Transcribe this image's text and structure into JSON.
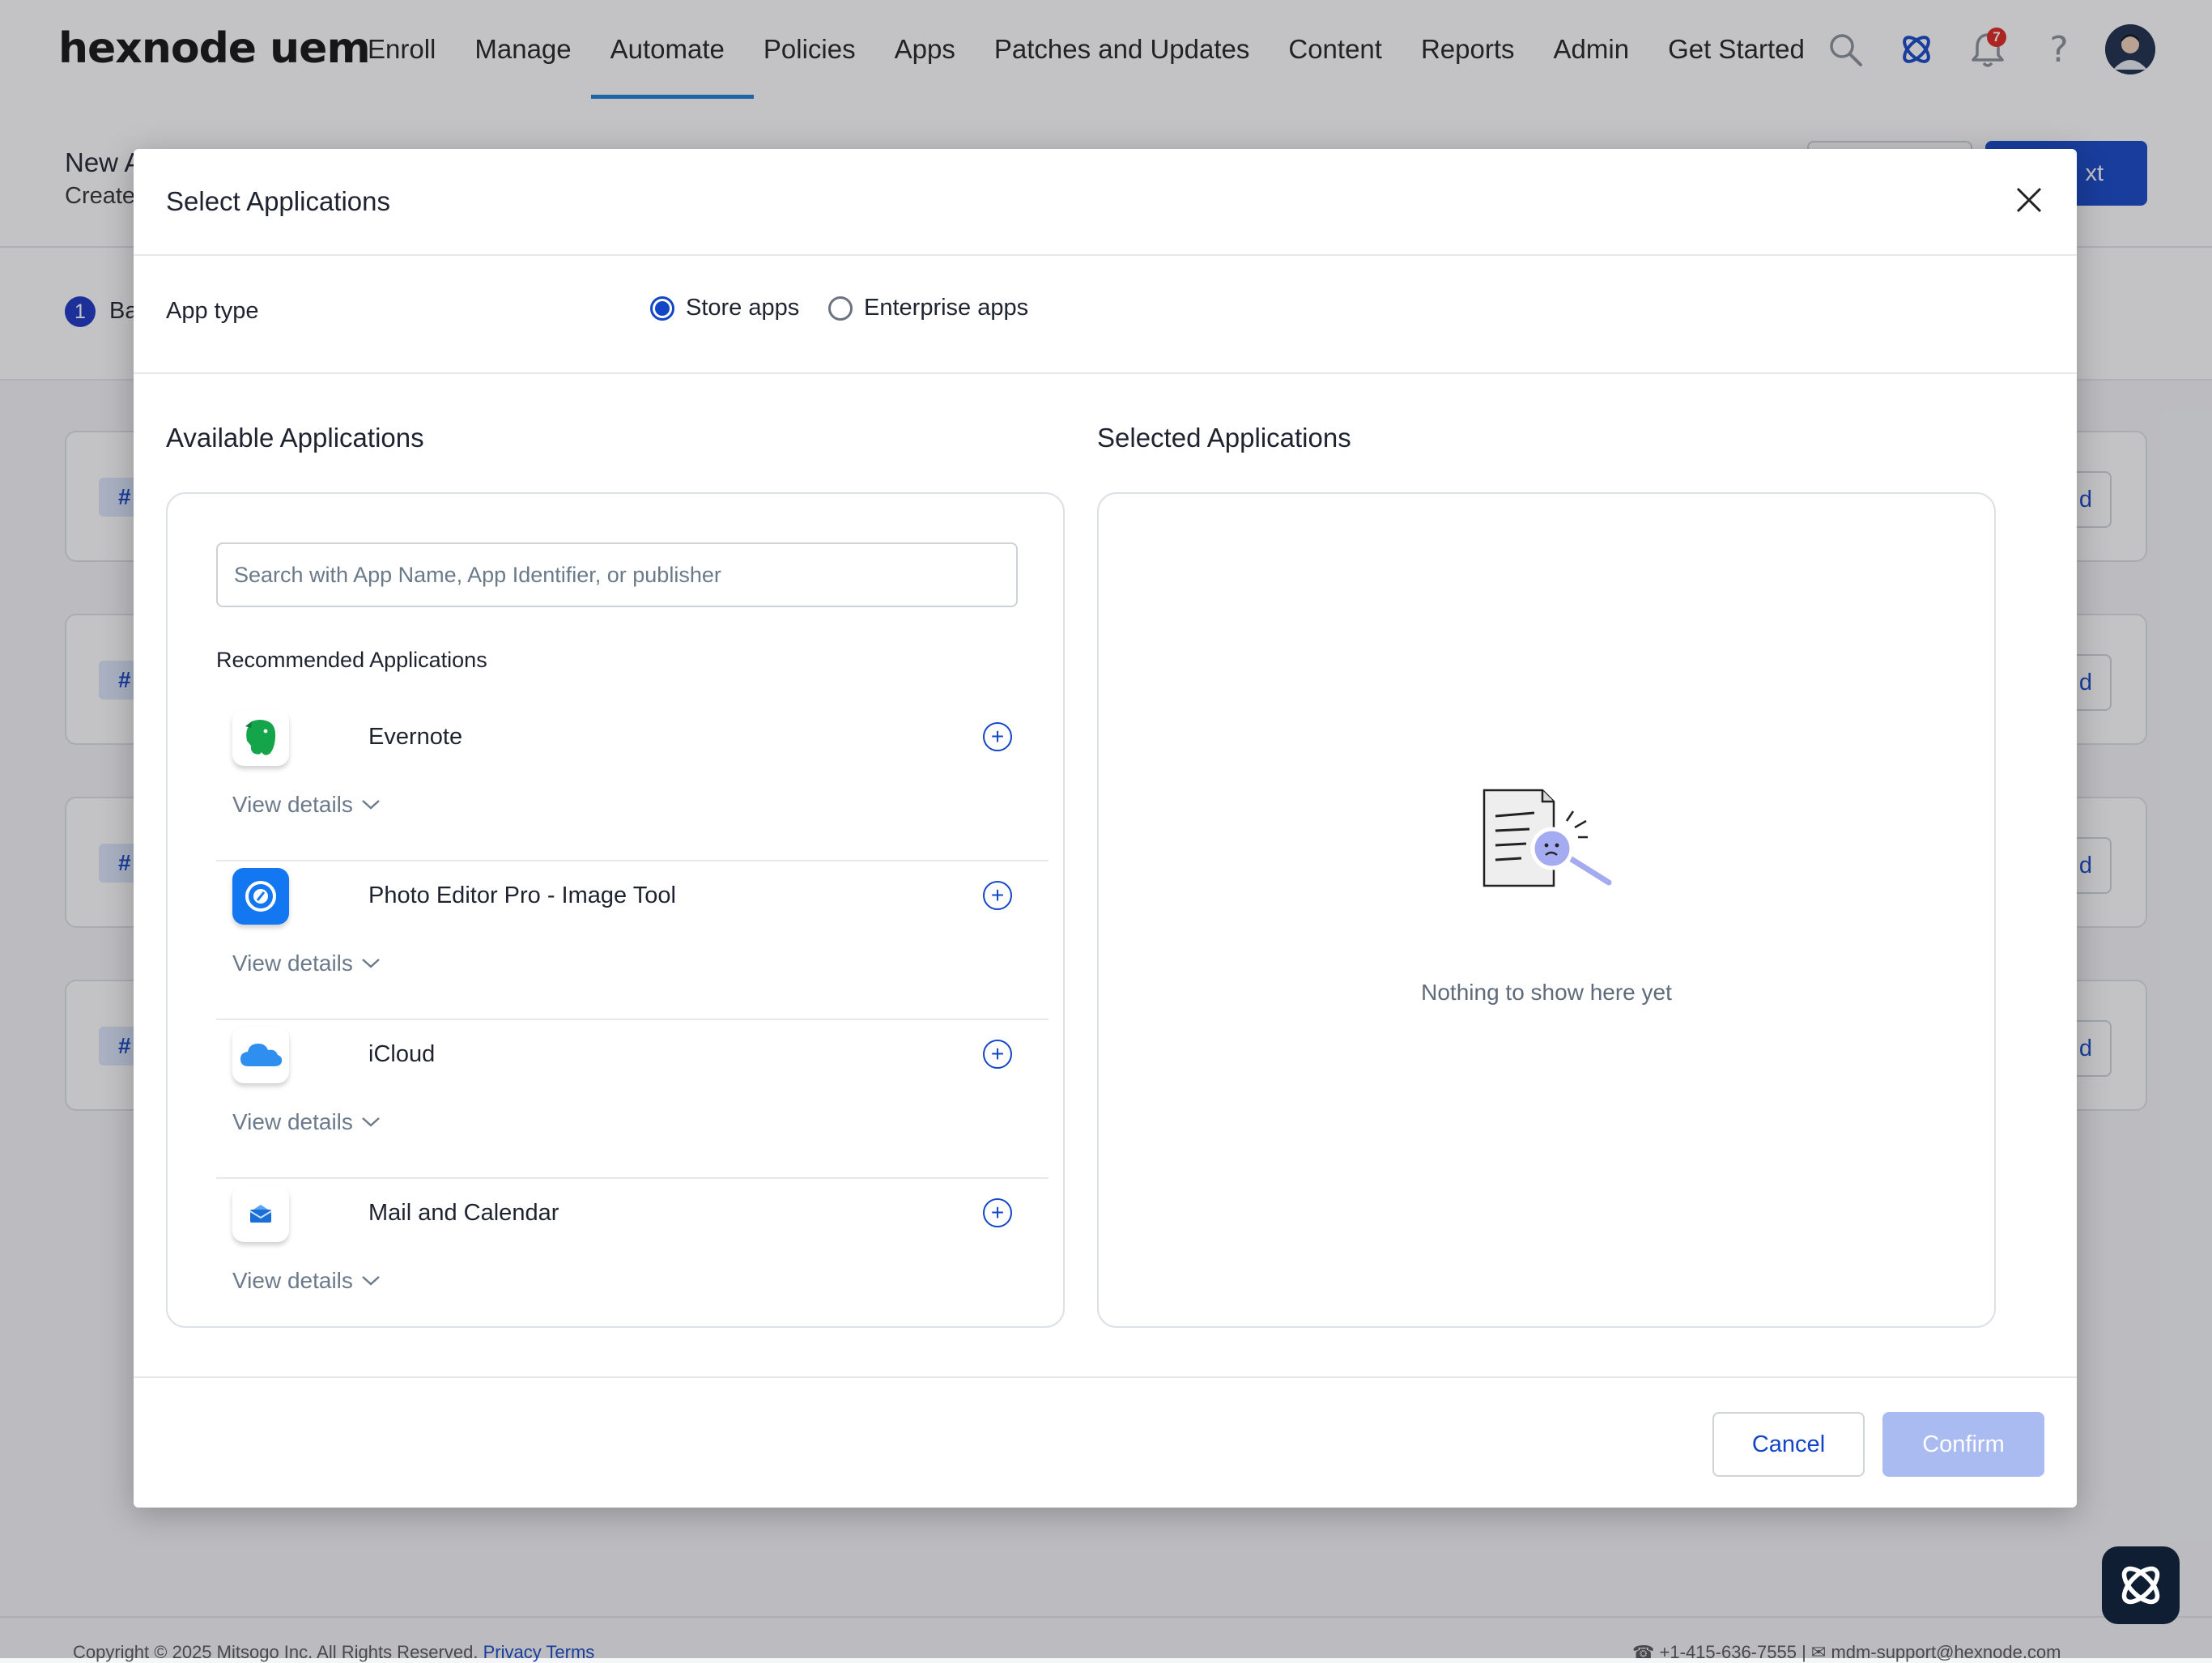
{
  "nav": {
    "logo": "hexnode uem",
    "menu": [
      "Enroll",
      "Manage",
      "Automate",
      "Policies",
      "Apps",
      "Patches and Updates",
      "Content",
      "Reports",
      "Admin",
      "Get Started"
    ],
    "active": "Automate",
    "notification_count": "7",
    "help_label": "?"
  },
  "background": {
    "page_title": "New A",
    "page_subtitle": "Create",
    "primary_button": "xt",
    "step_number": "1",
    "step_label": "Ba",
    "card_chip": "#",
    "card_button": "d",
    "footer_copyright": "Copyright © 2025 Mitsogo Inc. All Rights Reserved.",
    "footer_privacy": "Privacy",
    "footer_terms": "Terms",
    "footer_phone": "+1-415-636-7555",
    "footer_sep": "|",
    "footer_email": "mdm-support@hexnode.com"
  },
  "modal": {
    "title": "Select Applications",
    "app_type_label": "App type",
    "app_type_options": [
      {
        "label": "Store apps",
        "selected": true
      },
      {
        "label": "Enterprise apps",
        "selected": false
      }
    ],
    "available_title": "Available Applications",
    "selected_title": "Selected Applications",
    "search_placeholder": "Search with App Name, App Identifier, or publisher",
    "recommended_title": "Recommended Applications",
    "apps": [
      {
        "name": "Evernote",
        "icon": "evernote-icon",
        "details_label": "View details"
      },
      {
        "name": "Photo Editor Pro - Image Tool",
        "icon": "photo-editor-icon",
        "details_label": "View details"
      },
      {
        "name": "iCloud",
        "icon": "icloud-icon",
        "details_label": "View details"
      },
      {
        "name": "Mail and Calendar",
        "icon": "mail-calendar-icon",
        "details_label": "View details"
      }
    ],
    "empty_text": "Nothing to show here yet",
    "cancel_label": "Cancel",
    "confirm_label": "Confirm"
  },
  "colors": {
    "accent": "#1346c7",
    "confirm_disabled": "#a9bbf0",
    "nav_active_underline": "#1e7bd8",
    "badge": "#e0241f"
  }
}
